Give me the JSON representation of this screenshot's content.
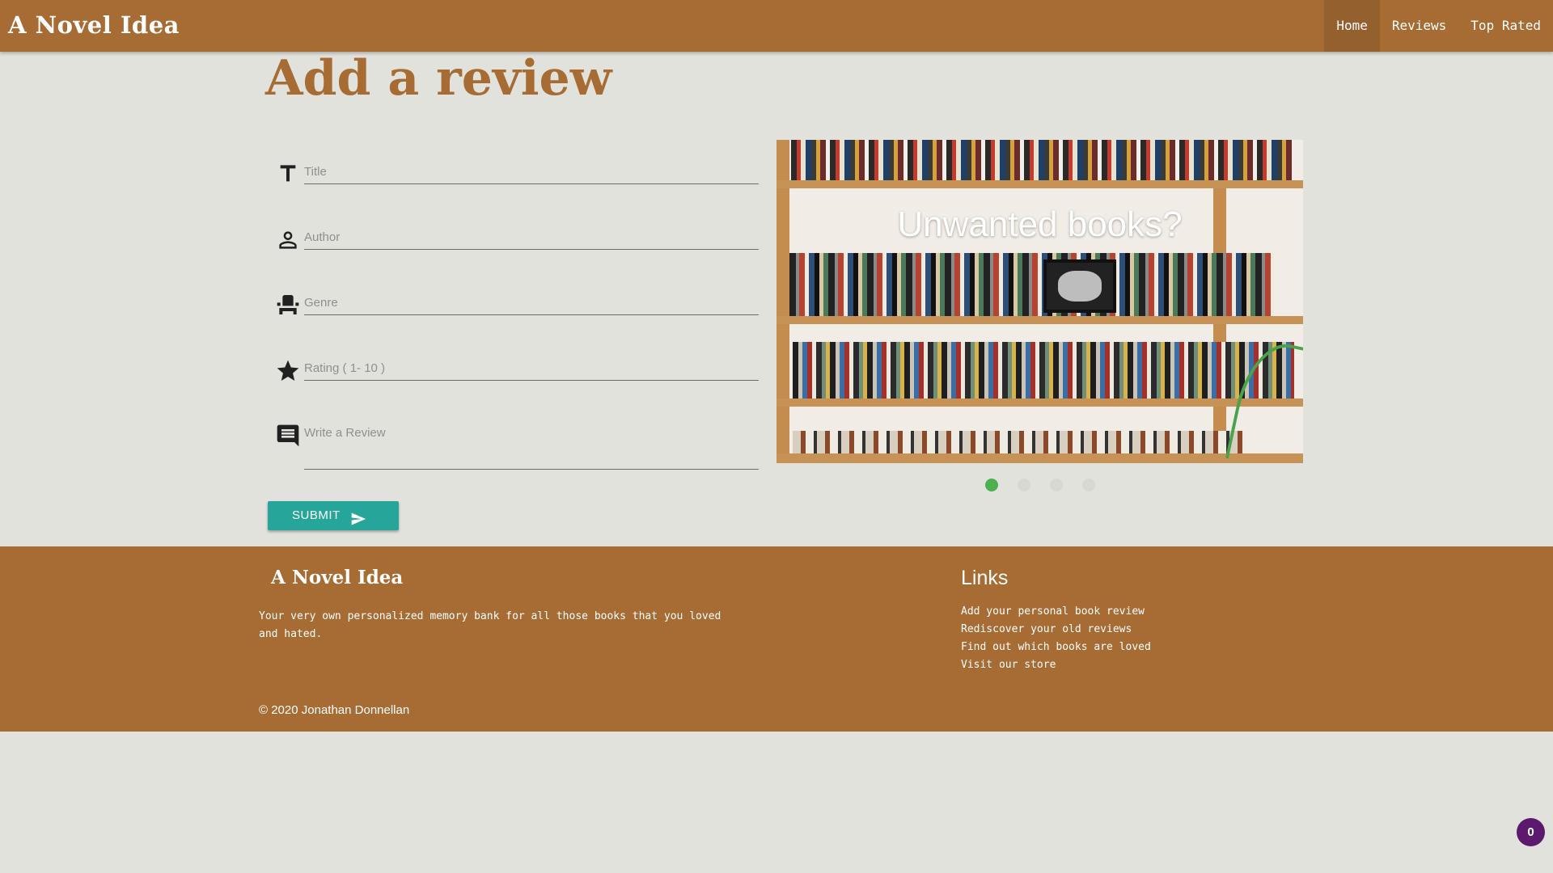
{
  "navbar": {
    "brand": "A Novel Idea",
    "links": [
      {
        "label": "Home",
        "active": true
      },
      {
        "label": "Reviews",
        "active": false
      },
      {
        "label": "Top Rated",
        "active": false
      }
    ]
  },
  "main": {
    "title": "Add a review",
    "form": {
      "title_placeholder": "Title",
      "author_placeholder": "Author",
      "genre_placeholder": "Genre",
      "rating_placeholder": "Rating ( 1- 10 )",
      "review_placeholder": "Write a Review",
      "icons": [
        "title-icon",
        "person-icon",
        "seat-icon",
        "star-icon",
        "comment-icon"
      ],
      "submit_label": "SUBMIT"
    },
    "carousel": {
      "caption": "Unwanted books?",
      "slide_count": 4,
      "active_index": 0,
      "active_color": "#4caf50"
    }
  },
  "footer": {
    "brand": "A Novel Idea",
    "description": "Your very own personalized memory bank for all those books that you loved and hated.",
    "links_title": "Links",
    "links": [
      "Add your personal book review",
      "Rediscover your old reviews",
      "Find out which books are loved",
      "Visit our store"
    ],
    "copyright": "© 2020 Jonathan Donnellan"
  },
  "badge": "0",
  "colors": {
    "brand": "#a66c34",
    "background": "#e2e2dc",
    "submit": "#26a69a",
    "badge": "#5c1a6e"
  }
}
